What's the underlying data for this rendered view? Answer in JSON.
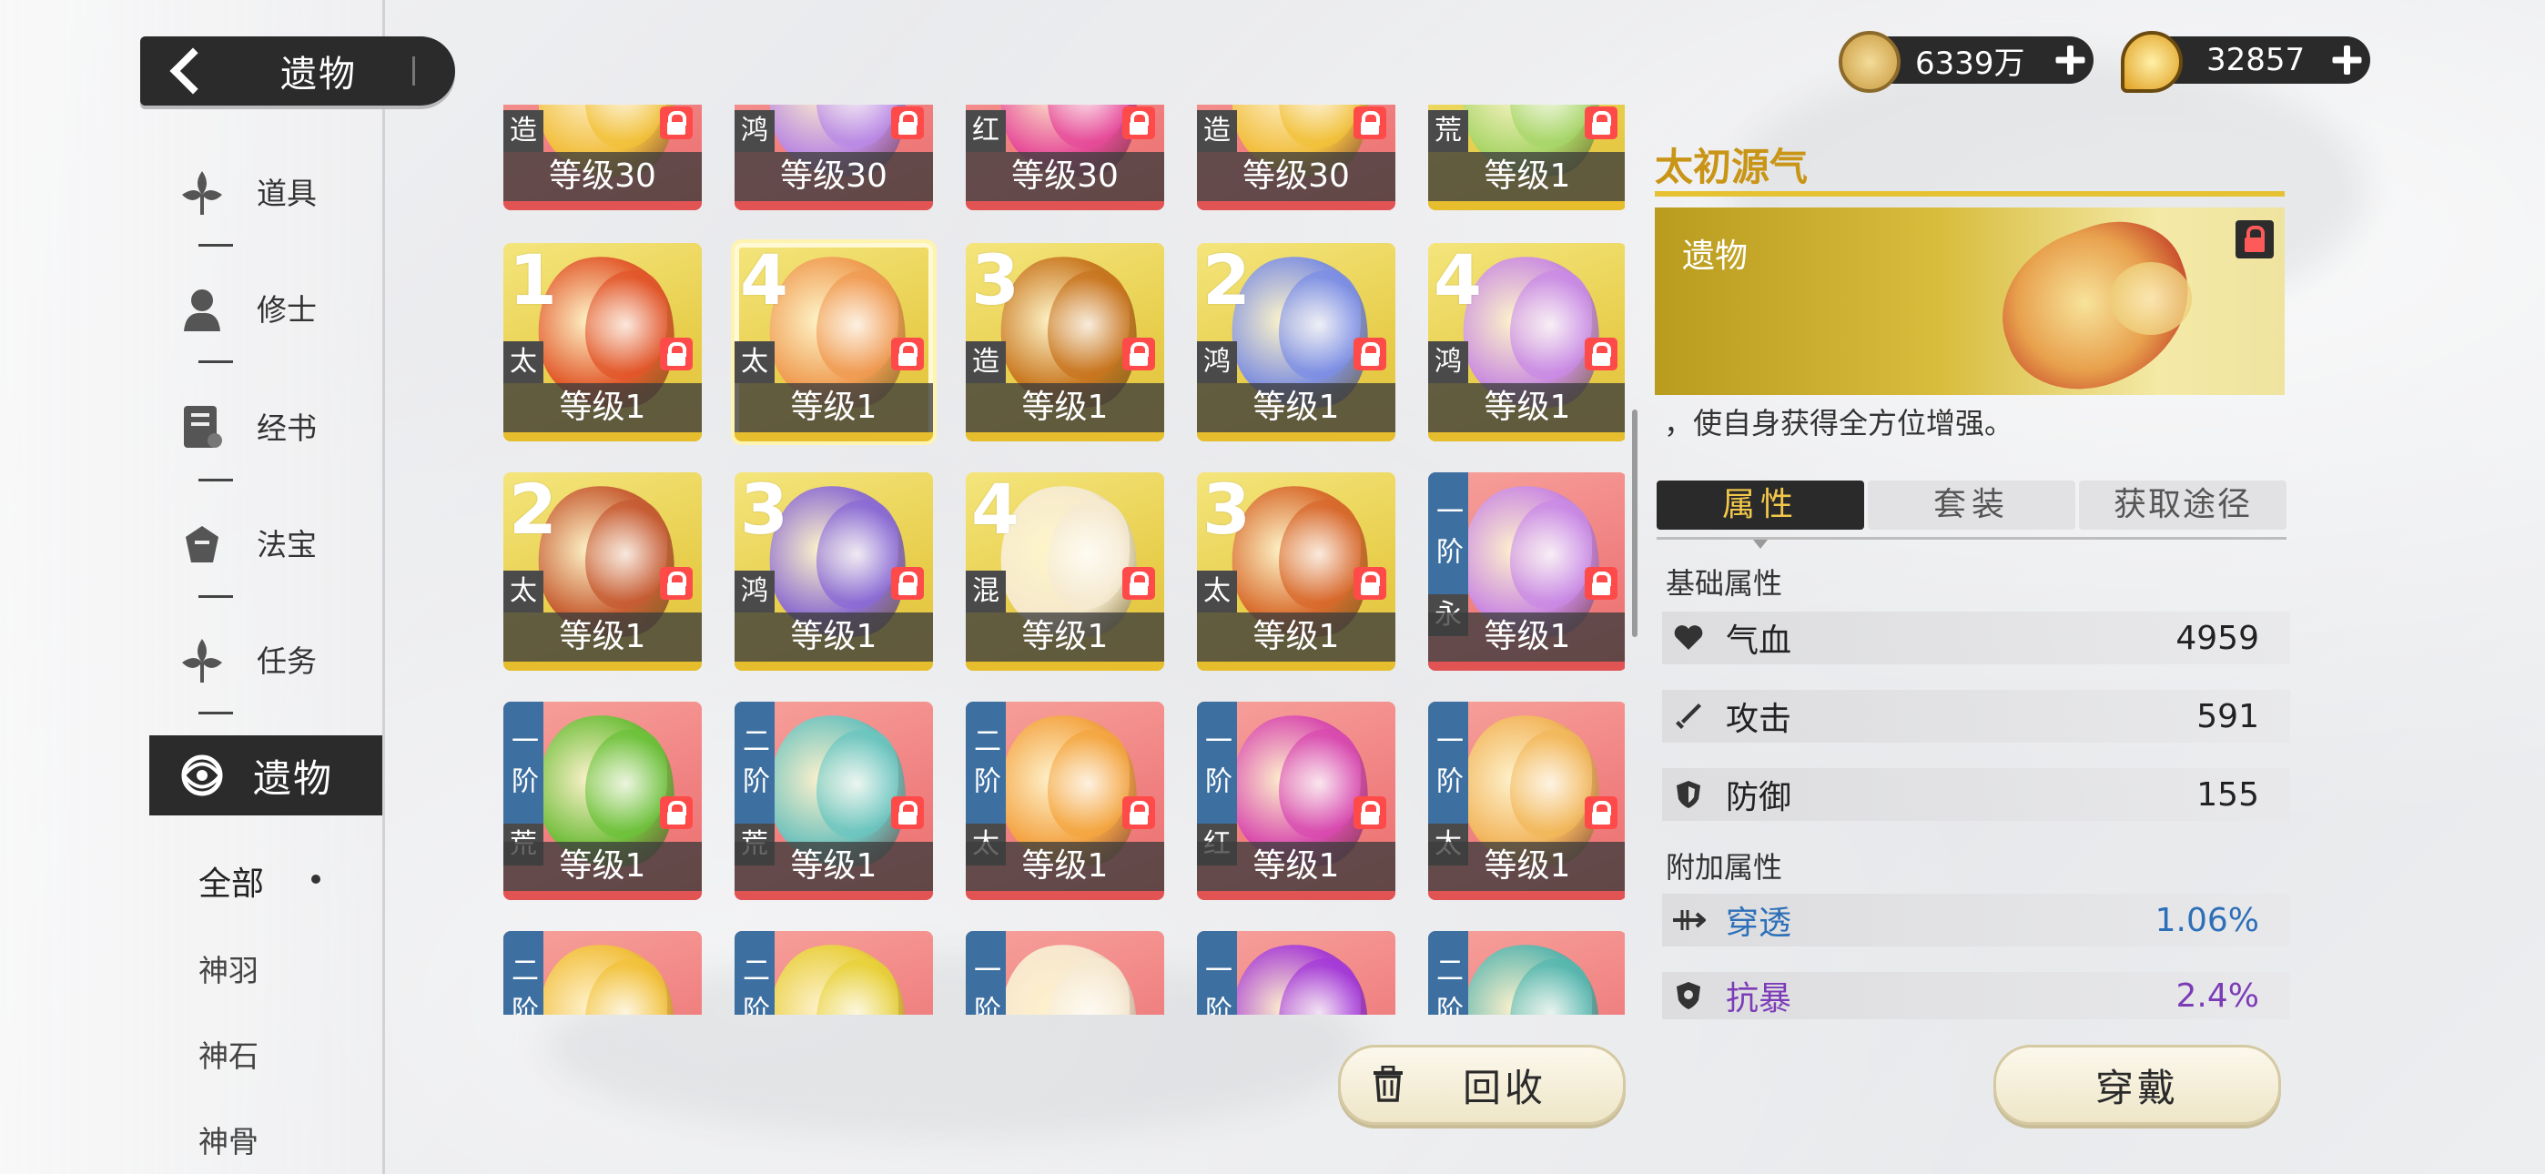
{
  "header": {
    "back_title": "遗物"
  },
  "currency": [
    {
      "name": "coin",
      "value": "6339万",
      "color": "#d9b45a"
    },
    {
      "name": "spirit",
      "value": "32857",
      "color": "#e0a020"
    }
  ],
  "sidebar": {
    "items": [
      {
        "label": "道具",
        "icon": "herb-icon"
      },
      {
        "label": "修士",
        "icon": "cultivator-icon"
      },
      {
        "label": "经书",
        "icon": "scripture-icon"
      },
      {
        "label": "法宝",
        "icon": "treasure-icon"
      },
      {
        "label": "任务",
        "icon": "task-icon"
      }
    ],
    "active_label": "遗物",
    "sub_items": [
      "全部",
      "神羽",
      "神石",
      "神骨"
    ]
  },
  "grid": {
    "cards": [
      {
        "color": "red",
        "set": "造",
        "level": "等级30",
        "num": "",
        "tier": "",
        "art": "#f2c23a"
      },
      {
        "color": "red",
        "set": "鸿",
        "level": "等级30",
        "num": "",
        "tier": "",
        "art": "#b98ae6"
      },
      {
        "color": "red",
        "set": "红",
        "level": "等级30",
        "num": "",
        "tier": "",
        "art": "#e64a9a"
      },
      {
        "color": "red",
        "set": "造",
        "level": "等级30",
        "num": "",
        "tier": "",
        "art": "#f2c23a"
      },
      {
        "color": "gold",
        "set": "荒",
        "level": "等级1",
        "num": "",
        "tier": "",
        "art": "#a7d66a"
      },
      {
        "color": "gold",
        "set": "太",
        "level": "等级1",
        "num": "1",
        "tier": "",
        "art": "#e2552a"
      },
      {
        "color": "gold",
        "set": "太",
        "level": "等级1",
        "num": "4",
        "tier": "",
        "art": "#f09a52",
        "selected": true
      },
      {
        "color": "gold",
        "set": "造",
        "level": "等级1",
        "num": "3",
        "tier": "",
        "art": "#c8741e"
      },
      {
        "color": "gold",
        "set": "鸿",
        "level": "等级1",
        "num": "2",
        "tier": "",
        "art": "#7c8ee6"
      },
      {
        "color": "gold",
        "set": "鸿",
        "level": "等级1",
        "num": "4",
        "tier": "",
        "art": "#c98ae6"
      },
      {
        "color": "gold",
        "set": "太",
        "level": "等级1",
        "num": "2",
        "tier": "",
        "art": "#c65a32"
      },
      {
        "color": "gold",
        "set": "鸿",
        "level": "等级1",
        "num": "3",
        "tier": "",
        "art": "#8a6ad6"
      },
      {
        "color": "gold",
        "set": "混",
        "level": "等级1",
        "num": "4",
        "tier": "",
        "art": "#f6ead2"
      },
      {
        "color": "gold",
        "set": "太",
        "level": "等级1",
        "num": "3",
        "tier": "",
        "art": "#d8682c"
      },
      {
        "color": "red",
        "set": "永",
        "level": "等级1",
        "num": "",
        "tier": "一阶",
        "art": "#c98ae6"
      },
      {
        "color": "red",
        "set": "荒",
        "level": "等级1",
        "num": "",
        "tier": "一阶",
        "art": "#6cc23a"
      },
      {
        "color": "red",
        "set": "荒",
        "level": "等级1",
        "num": "",
        "tier": "二阶",
        "art": "#6ac6c0"
      },
      {
        "color": "red",
        "set": "太",
        "level": "等级1",
        "num": "",
        "tier": "二阶",
        "art": "#f4a640"
      },
      {
        "color": "red",
        "set": "红",
        "level": "等级1",
        "num": "",
        "tier": "一阶",
        "art": "#d84ab0"
      },
      {
        "color": "red",
        "set": "太",
        "level": "等级1",
        "num": "",
        "tier": "一阶",
        "art": "#f2b85a"
      },
      {
        "color": "red",
        "set": "",
        "level": "",
        "num": "",
        "tier": "二阶",
        "art": "#f2c23a"
      },
      {
        "color": "red",
        "set": "",
        "level": "",
        "num": "",
        "tier": "二阶",
        "art": "#e8d23a"
      },
      {
        "color": "red",
        "set": "",
        "level": "",
        "num": "",
        "tier": "一阶",
        "art": "#f6ead2"
      },
      {
        "color": "red",
        "set": "",
        "level": "",
        "num": "",
        "tier": "一阶",
        "art": "#a43ad8"
      },
      {
        "color": "red",
        "set": "",
        "level": "",
        "num": "",
        "tier": "二阶",
        "art": "#56b8b0"
      }
    ]
  },
  "detail": {
    "title": "太初源气",
    "banner_label": "遗物",
    "description": "，使自身获得全方位增强。",
    "tabs": [
      "属性",
      "套装",
      "获取途径"
    ],
    "base_section": "基础属性",
    "base_stats": [
      {
        "name": "气血",
        "value": "4959",
        "icon": "heart-icon"
      },
      {
        "name": "攻击",
        "value": "591",
        "icon": "sword-icon"
      },
      {
        "name": "防御",
        "value": "155",
        "icon": "shield-icon"
      }
    ],
    "extra_section": "附加属性",
    "extra_stats": [
      {
        "name": "穿透",
        "value": "1.06%",
        "icon": "pierce-icon",
        "style": "blue"
      },
      {
        "name": "抗暴",
        "value": "2.4%",
        "icon": "anti-crit-icon",
        "style": "purple"
      }
    ]
  },
  "actions": {
    "recycle": "回收",
    "equip": "穿戴"
  }
}
